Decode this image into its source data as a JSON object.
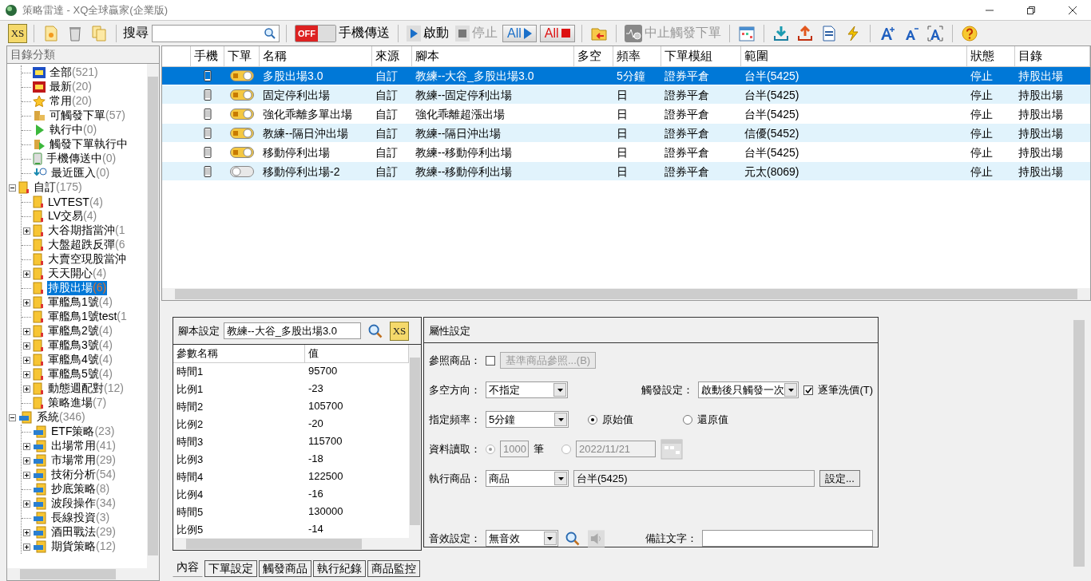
{
  "window": {
    "title": "策略雷達 - XQ全球贏家(企業版)"
  },
  "toolbar": [
    {
      "kind": "xs",
      "label": "XS"
    },
    {
      "kind": "separator"
    },
    {
      "kind": "new"
    },
    {
      "kind": "delete"
    },
    {
      "kind": "copy"
    },
    {
      "kind": "separator"
    },
    {
      "kind": "search",
      "label": "搜尋"
    },
    {
      "kind": "separator"
    },
    {
      "kind": "toggle",
      "label": "手機傳送",
      "switch_text": "OFF",
      "on": false
    },
    {
      "kind": "separator"
    },
    {
      "kind": "start",
      "label": "啟動",
      "disabled": false
    },
    {
      "kind": "stop",
      "label": "停止",
      "disabled": true
    },
    {
      "kind": "all-start",
      "label": "All"
    },
    {
      "kind": "all-stop",
      "label": "All"
    },
    {
      "kind": "separator"
    },
    {
      "kind": "import"
    },
    {
      "kind": "separator"
    },
    {
      "kind": "halt",
      "label": "中止觸發下單",
      "disabled": true
    },
    {
      "kind": "separator"
    },
    {
      "kind": "calendar"
    },
    {
      "kind": "separator"
    },
    {
      "kind": "download"
    },
    {
      "kind": "upload"
    },
    {
      "kind": "report"
    },
    {
      "kind": "flash"
    },
    {
      "kind": "separator"
    },
    {
      "kind": "font-up"
    },
    {
      "kind": "font-down"
    },
    {
      "kind": "font-fit"
    },
    {
      "kind": "separator"
    },
    {
      "kind": "help"
    }
  ],
  "sidebar": {
    "title": "目錄分類",
    "items": [
      {
        "children": [
          {
            "label": "全部",
            "count": "(521)",
            "kind": "all",
            "selected": false
          },
          {
            "label": "最新",
            "count": "(20)",
            "kind": "new",
            "selected": false
          },
          {
            "label": "常用",
            "count": "(20)",
            "kind": "star",
            "selected": false
          },
          {
            "label": "可觸發下單",
            "count": "(57)",
            "kind": "coins",
            "selected": false
          },
          {
            "label": "執行中",
            "count": "(0)",
            "kind": "play",
            "selected": false
          },
          {
            "label": "觸發下單執行中",
            "kind": "coins-play",
            "selected": false
          },
          {
            "label": "手機傳送中",
            "count": "(0)",
            "kind": "phone",
            "selected": false
          },
          {
            "label": "最近匯入",
            "count": "(0)",
            "kind": "import",
            "selected": false
          }
        ]
      },
      {
        "label": "自訂",
        "count": "(175)",
        "kind": "folder",
        "selected": false,
        "expanded": true,
        "children": [
          {
            "label": "LVTEST",
            "count": "(4)",
            "kind": "folder",
            "selected": false
          },
          {
            "label": "LV交易",
            "count": "(4)",
            "kind": "folder",
            "selected": false
          },
          {
            "label": "大谷期指當沖",
            "count": "(1",
            "kind": "folder",
            "selected": false,
            "expanded": false
          },
          {
            "label": "大盤超跌反彈",
            "count": "(6",
            "kind": "folder",
            "selected": false
          },
          {
            "label": "大賣空現股當沖",
            "kind": "folder",
            "selected": false
          },
          {
            "label": "天天開心",
            "count": "(4)",
            "kind": "folder",
            "selected": false,
            "expanded": false
          },
          {
            "label": "持股出場",
            "count": "(6)",
            "kind": "folder",
            "selected": true
          },
          {
            "label": "軍艦鳥1號",
            "count": "(4)",
            "kind": "folder",
            "selected": false,
            "expanded": false
          },
          {
            "label": "軍艦鳥1號test",
            "count": "(1",
            "kind": "folder",
            "selected": false
          },
          {
            "label": "軍艦鳥2號",
            "count": "(4)",
            "kind": "folder",
            "selected": false,
            "expanded": false
          },
          {
            "label": "軍艦鳥3號",
            "count": "(4)",
            "kind": "folder",
            "selected": false,
            "expanded": false
          },
          {
            "label": "軍艦鳥4號",
            "count": "(4)",
            "kind": "folder",
            "selected": false,
            "expanded": false
          },
          {
            "label": "軍艦鳥5號",
            "count": "(4)",
            "kind": "folder",
            "selected": false,
            "expanded": false
          },
          {
            "label": "動態週配對",
            "count": "(12)",
            "kind": "folder",
            "selected": false,
            "expanded": false
          },
          {
            "label": "策略進場",
            "count": "(7)",
            "kind": "folder",
            "selected": false
          }
        ]
      },
      {
        "label": "系統",
        "count": "(346)",
        "kind": "sys-folder",
        "selected": false,
        "expanded": true,
        "children": [
          {
            "label": "ETF策略",
            "count": "(23)",
            "kind": "sys-folder",
            "selected": false
          },
          {
            "label": "出場常用",
            "count": "(41)",
            "kind": "sys-folder",
            "selected": false,
            "expanded": false
          },
          {
            "label": "市場常用",
            "count": "(29)",
            "kind": "sys-folder",
            "selected": false,
            "expanded": false
          },
          {
            "label": "技術分析",
            "count": "(54)",
            "kind": "sys-folder",
            "selected": false,
            "expanded": false
          },
          {
            "label": "抄底策略",
            "count": "(8)",
            "kind": "sys-folder",
            "selected": false
          },
          {
            "label": "波段操作",
            "count": "(34)",
            "kind": "sys-folder",
            "selected": false,
            "expanded": false
          },
          {
            "label": "長線投資",
            "count": "(3)",
            "kind": "sys-folder",
            "selected": false
          },
          {
            "label": "酒田戰法",
            "count": "(29)",
            "kind": "sys-folder",
            "selected": false,
            "expanded": false
          },
          {
            "label": "期貨策略",
            "count": "(12)",
            "kind": "sys-folder",
            "selected": false,
            "expanded": false
          }
        ]
      }
    ]
  },
  "table": {
    "columns": [
      "手機",
      "下單",
      "名稱",
      "來源",
      "腳本",
      "多空",
      "頻率",
      "下單模組",
      "範圍",
      "狀態",
      "目錄"
    ],
    "rows": [
      {
        "selected": true,
        "order_on": true,
        "name": "多股出場3.0",
        "source": "自訂",
        "script": "教練--大谷_多股出場3.0",
        "frequency": "5分鐘",
        "module": "證券平倉",
        "range": "台半(5425)",
        "status": "停止",
        "folder": "持股出場"
      },
      {
        "selected": false,
        "order_on": true,
        "name": "固定停利出場",
        "source": "自訂",
        "script": "教練--固定停利出場",
        "frequency": "日",
        "module": "證券平倉",
        "range": "台半(5425)",
        "status": "停止",
        "folder": "持股出場"
      },
      {
        "selected": false,
        "order_on": true,
        "name": "強化乖離多單出場",
        "source": "自訂",
        "script": "強化乖離超漲出場",
        "frequency": "日",
        "module": "證券平倉",
        "range": "台半(5425)",
        "status": "停止",
        "folder": "持股出場"
      },
      {
        "selected": false,
        "order_on": true,
        "name": "教練--隔日沖出場",
        "source": "自訂",
        "script": "教練--隔日沖出場",
        "frequency": "日",
        "module": "證券平倉",
        "range": "信優(5452)",
        "status": "停止",
        "folder": "持股出場"
      },
      {
        "selected": false,
        "order_on": true,
        "name": "移動停利出場",
        "source": "自訂",
        "script": "教練--移動停利出場",
        "frequency": "日",
        "module": "證券平倉",
        "range": "台半(5425)",
        "status": "停止",
        "folder": "持股出場"
      },
      {
        "selected": false,
        "order_on": false,
        "name": "移動停利出場-2",
        "source": "自訂",
        "script": "教練--移動停利出場",
        "frequency": "日",
        "module": "證券平倉",
        "range": "元太(8069)",
        "status": "停止",
        "folder": "持股出場"
      }
    ]
  },
  "script_panel": {
    "label": "腳本設定",
    "value": "教練--大谷_多股出場3.0",
    "xs_label": "XS",
    "columns": [
      "參數名稱",
      "值"
    ],
    "params": [
      {
        "name": "時間1",
        "value": "95700"
      },
      {
        "name": "比例1",
        "value": "-23"
      },
      {
        "name": "時間2",
        "value": "105700"
      },
      {
        "name": "比例2",
        "value": "-20"
      },
      {
        "name": "時間3",
        "value": "115700"
      },
      {
        "name": "比例3",
        "value": "-18"
      },
      {
        "name": "時間4",
        "value": "122500"
      },
      {
        "name": "比例4",
        "value": "-16"
      },
      {
        "name": "時間5",
        "value": "130000"
      },
      {
        "name": "比例5",
        "value": "-14"
      }
    ]
  },
  "properties": {
    "title": "屬性設定",
    "reference": {
      "label": "參照商品：",
      "checked": false,
      "button": "基準商品參照...(B)"
    },
    "direction": {
      "label": "多空方向：",
      "value": "不指定"
    },
    "trigger": {
      "label": "觸發設定：",
      "value": "啟動後只觸發一次",
      "check_label": "逐筆洗價(T)",
      "checked": true
    },
    "frequency": {
      "label": "指定頻率：",
      "value": "5分鐘",
      "options": [
        {
          "label": "原始值",
          "selected": true
        },
        {
          "label": "還原值",
          "selected": false
        }
      ]
    },
    "data_read": {
      "label": "資料讀取：",
      "count": "1000",
      "unit": "筆",
      "date": "2022/11/21",
      "by_count_selected": true,
      "by_date_selected": false
    },
    "product": {
      "label": "執行商品：",
      "value": "商品",
      "product": "台半(5425)",
      "button": "設定..."
    },
    "sound": {
      "label": "音效設定：",
      "value": "無音效"
    },
    "note": {
      "label": "備註文字："
    }
  },
  "tabs": [
    {
      "label": "內容",
      "selected": true
    },
    {
      "label": "下單設定",
      "selected": false
    },
    {
      "label": "觸發商品",
      "selected": false
    },
    {
      "label": "執行紀錄",
      "selected": false
    },
    {
      "label": "商品監控",
      "selected": false
    }
  ]
}
